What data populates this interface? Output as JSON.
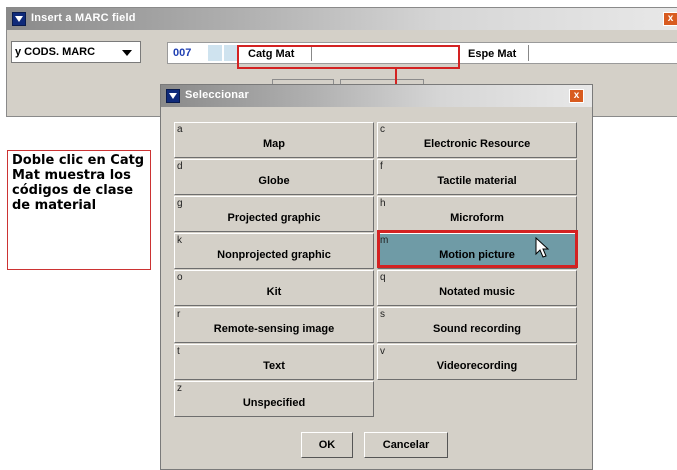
{
  "main_window": {
    "title": "Insert a MARC field",
    "close": "x",
    "combo_value": "y CODS. MARC",
    "tag": "007",
    "field1_label": "Catg Mat",
    "field1_value": "",
    "field2_label": "Espe Mat",
    "field2_value": ""
  },
  "callout": {
    "text": "Doble clic en Catg Mat muestra los códigos de clase de material"
  },
  "dialog": {
    "title": "Seleccionar",
    "close": "x",
    "options": [
      {
        "code": "a",
        "label": "Map"
      },
      {
        "code": "c",
        "label": "Electronic Resource"
      },
      {
        "code": "d",
        "label": "Globe"
      },
      {
        "code": "f",
        "label": "Tactile material"
      },
      {
        "code": "g",
        "label": "Projected graphic"
      },
      {
        "code": "h",
        "label": "Microform"
      },
      {
        "code": "k",
        "label": "Nonprojected graphic"
      },
      {
        "code": "m",
        "label": "Motion picture"
      },
      {
        "code": "o",
        "label": "Kit"
      },
      {
        "code": "q",
        "label": "Notated music"
      },
      {
        "code": "r",
        "label": "Remote-sensing image"
      },
      {
        "code": "s",
        "label": "Sound recording"
      },
      {
        "code": "t",
        "label": "Text"
      },
      {
        "code": "v",
        "label": "Videorecording"
      },
      {
        "code": "z",
        "label": "Unspecified"
      }
    ],
    "selected_code": "m",
    "ok_label": "OK",
    "cancel_label": "Cancelar"
  },
  "colors": {
    "highlight_red": "#d32222",
    "selected_bg": "#6f9ba6",
    "tag_blue": "#1f3fb2"
  }
}
